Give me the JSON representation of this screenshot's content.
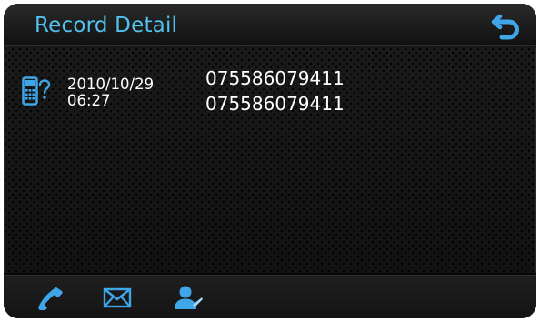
{
  "header": {
    "title": "Record Detail",
    "back_icon": "back-arrow-icon"
  },
  "record": {
    "type_icon": "unknown-call-phone-icon",
    "date": "2010/10/29",
    "time": "06:27",
    "name": "075586079411",
    "number": "075586079411"
  },
  "footer": {
    "buttons": [
      {
        "icon": "phone-icon",
        "action": "call"
      },
      {
        "icon": "envelope-icon",
        "action": "message"
      },
      {
        "icon": "contact-person-icon",
        "action": "contacts"
      }
    ]
  },
  "colors": {
    "accent": "#51c3ee",
    "icon_blue": "#3fa7e8",
    "text": "#ffffff",
    "background": "#151515"
  }
}
